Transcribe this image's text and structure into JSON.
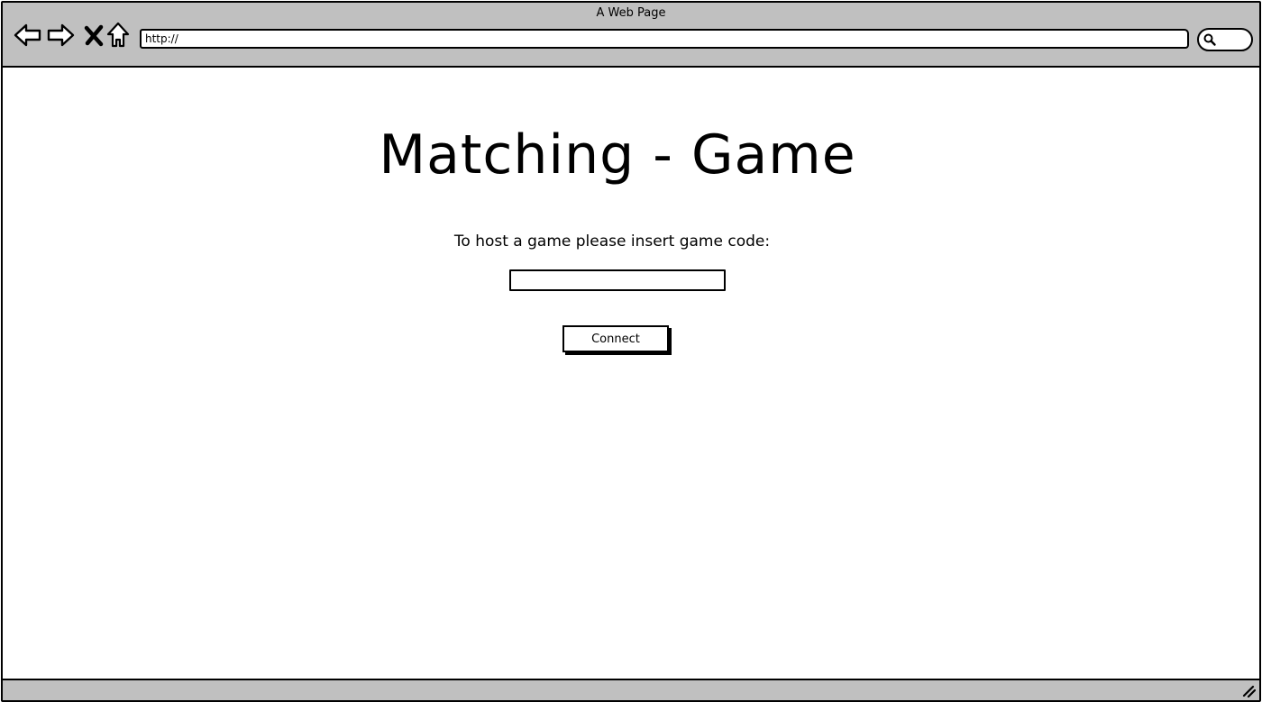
{
  "window": {
    "title": "A Web Page",
    "url": "http://"
  },
  "icons": {
    "back": "back-arrow-icon",
    "forward": "forward-arrow-icon",
    "stop": "close-icon",
    "home": "home-icon",
    "search": "search-icon",
    "resize": "resize-grip-icon"
  },
  "main": {
    "heading": "Matching - Game",
    "prompt": "To host a game please insert game code:",
    "code_value": "",
    "connect_label": "Connect"
  },
  "colors": {
    "chrome": "#c0c0c0",
    "ink": "#000000",
    "page": "#ffffff"
  }
}
